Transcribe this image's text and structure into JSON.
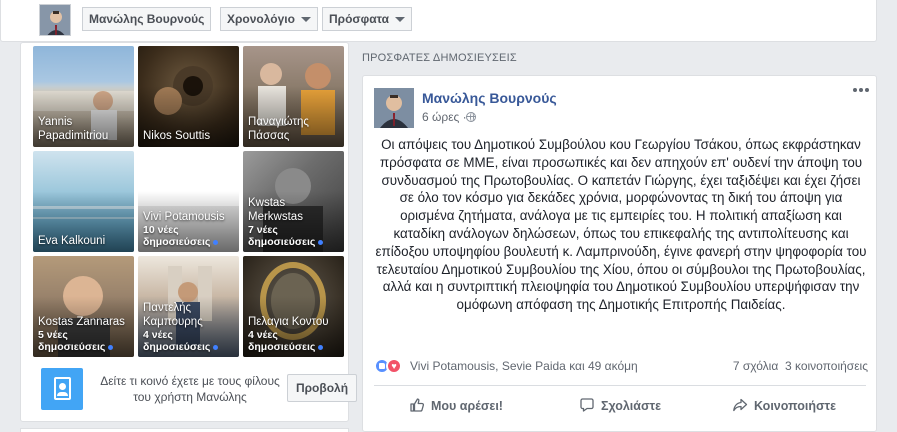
{
  "topnav": {
    "profile_name": "Μανώλης Βουρνούς",
    "timeline_label": "Χρονολόγιο",
    "recent_label": "Πρόσφατα"
  },
  "friends": [
    {
      "name": "Yannis Papadimitriou",
      "sub": ""
    },
    {
      "name": "Nikos Souttis",
      "sub": ""
    },
    {
      "name": "Παναγιώτης Πάσσας",
      "sub": ""
    },
    {
      "name": "Eva Kalkouni",
      "sub": ""
    },
    {
      "name": "Vivi Potamousis",
      "sub": "10 νέες δημοσιεύσεις"
    },
    {
      "name": "Kwstas Merkwstas",
      "sub": "7 νέες δημοσιεύσεις"
    },
    {
      "name": "Kostas Zannaras",
      "sub": "5 νέες δημοσιεύσεις"
    },
    {
      "name": "Παντελής Καμπουρης",
      "sub": "4 νέες δημοσιεύσεις"
    },
    {
      "name": "Πελαγια Κοντου",
      "sub": "4 νέες δημοσιεύσεις"
    }
  ],
  "cta": {
    "text": "Δείτε τι κοινό έχετε με τους φίλους του χρήστη Μανώλης",
    "button": "Προβολή"
  },
  "recent_header": "ΠΡΟΣΦΑΤΕΣ ΔΗΜΟΣΙΕΥΣΕΙΣ",
  "post": {
    "author": "Μανώλης Βουρνούς",
    "time": "6 ώρες ·",
    "text": "Οι απόψεις του Δημοτικού Συμβούλου κου Γεωργίου Τσάκου, όπως εκφράστηκαν πρόσφατα σε ΜΜΕ, είναι προσωπικές και δεν απηχούν επ' ουδενί την άποψη του συνδυασμού της Πρωτοβουλίας. Ο καπετάν Γιώργης, έχει ταξιδέψει και έχει ζήσει σε όλο τον κόσμο για δεκάδες χρόνια, μορφώνοντας τη δική του άποψη για ορισμένα ζητήματα, ανάλογα με τις εμπειρίες του. Η πολιτική απαξίωση και καταδίκη ανάλογων δηλώσεων, όπως του επικεφαλής της αντιπολίτευσης και επίδοξου υποψηφίου βουλευτή κ. Λαμπρινούδη, έγινε φανερή στην ψηφοφορία του τελευταίου Δημοτικού Συμβουλίου της Χίου, όπου οι σύμβουλοι της Πρωτοβουλίας, αλλά και η συντριπτική πλειοψηφία του Δημοτικού Συμβουλίου υπερψήφισαν την ομόφωνη απόφαση της Δημοτικής Επιτροπής Παιδείας.",
    "reactions": "Vivi Potamousis, Sevie Paida και 49 ακόμη",
    "comments": "7 σχόλια",
    "shares": "3 κοινοποιήσεις",
    "like_label": "Μου αρέσει!",
    "comment_label": "Σχολιάστε",
    "share_label": "Κοινοποιήστε"
  }
}
